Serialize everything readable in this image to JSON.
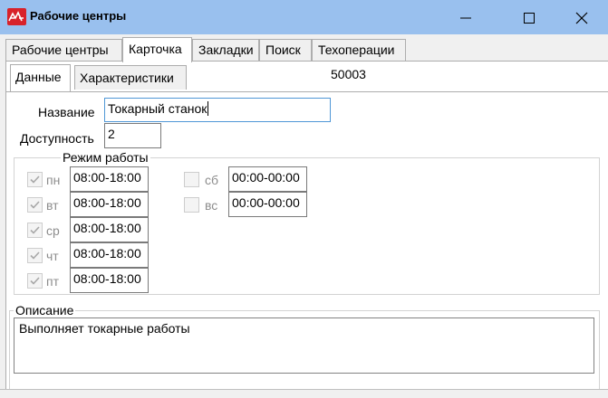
{
  "window": {
    "title": "Рабочие центры"
  },
  "tabs": [
    {
      "label": "Рабочие центры"
    },
    {
      "label": "Карточка"
    },
    {
      "label": "Закладки"
    },
    {
      "label": "Поиск"
    },
    {
      "label": "Техоперации"
    }
  ],
  "active_tab": "Карточка",
  "subtabs": [
    {
      "label": "Данные"
    },
    {
      "label": "Характеристики"
    }
  ],
  "active_subtab": "Данные",
  "record_id": "50003",
  "form": {
    "name_label": "Название",
    "name_value": "Токарный станок",
    "availability_label": "Доступность",
    "availability_value": "2",
    "schedule_legend": "Режим работы",
    "days": [
      {
        "label": "пн",
        "hours": "08:00-18:00",
        "checked": true
      },
      {
        "label": "вт",
        "hours": "08:00-18:00",
        "checked": true
      },
      {
        "label": "ср",
        "hours": "08:00-18:00",
        "checked": true
      },
      {
        "label": "чт",
        "hours": "08:00-18:00",
        "checked": true
      },
      {
        "label": "пт",
        "hours": "08:00-18:00",
        "checked": true
      },
      {
        "label": "сб",
        "hours": "00:00-00:00",
        "checked": false
      },
      {
        "label": "вс",
        "hours": "00:00-00:00",
        "checked": false
      }
    ],
    "description_legend": "Описание",
    "description_value": "Выполняет токарные работы"
  },
  "colors": {
    "titlebar": "#99c0ee",
    "app_icon": "#d8222a",
    "focus_border": "#4f97d6"
  },
  "icons": {
    "app": "app-logo-icon",
    "minimize": "minimize-icon",
    "maximize": "maximize-icon",
    "close": "close-icon",
    "check": "check-icon"
  }
}
